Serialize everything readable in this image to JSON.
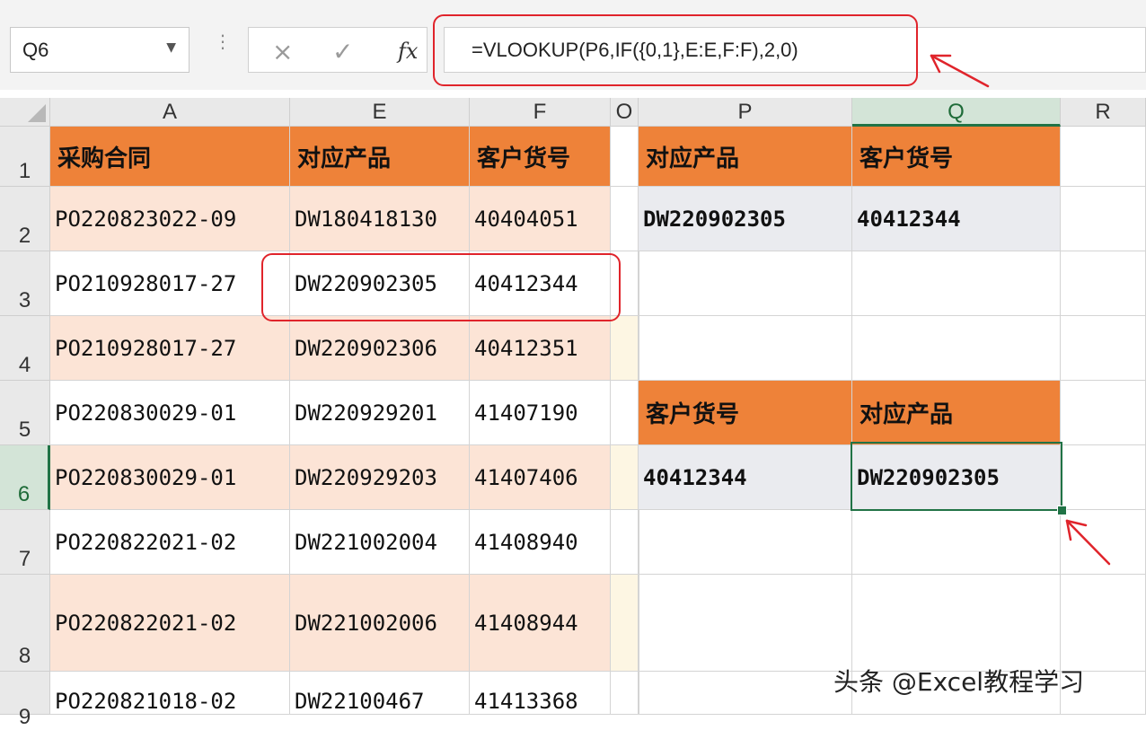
{
  "namebox": {
    "cell_ref": "Q6"
  },
  "formula_bar": {
    "formula": "=VLOOKUP(P6,IF({0,1},E:E,F:F),2,0)"
  },
  "icons": {
    "cancel": "×",
    "enter": "✓",
    "fx": "fx",
    "dropdown": "▼",
    "dots": "⋮"
  },
  "column_headers": [
    "A",
    "E",
    "F",
    "O",
    "P",
    "Q",
    "R"
  ],
  "row_headers": [
    "1",
    "2",
    "3",
    "4",
    "5",
    "6",
    "7",
    "8",
    "9"
  ],
  "table": {
    "headers": [
      "采购合同",
      "对应产品",
      "客户货号"
    ],
    "rows": [
      [
        "PO220823022-09",
        "DW180418130",
        "40404051"
      ],
      [
        "PO210928017-27",
        "DW220902305",
        "40412344"
      ],
      [
        "PO210928017-27",
        "DW220902306",
        "40412351"
      ],
      [
        "PO220830029-01",
        "DW220929201",
        "41407190"
      ],
      [
        "PO220830029-01",
        "DW220929203",
        "41407406"
      ],
      [
        "PO220822021-02",
        "DW221002004",
        "41408940"
      ],
      [
        "PO220822021-02",
        "DW221002006",
        "41408944"
      ],
      [
        "PO220821018-02",
        "DW22100467",
        "41413368"
      ]
    ]
  },
  "lookup1": {
    "headers": [
      "对应产品",
      "客户货号"
    ],
    "values": [
      "DW220902305",
      "40412344"
    ]
  },
  "lookup2": {
    "headers": [
      "客户货号",
      "对应产品"
    ],
    "values": [
      "40412344",
      "DW220902305"
    ]
  },
  "colors": {
    "header_orange": "#ee8239",
    "peach": "#fce4d6",
    "annotation_red": "#e0242b",
    "selection_green": "#217346"
  },
  "watermark": "头条 @Excel教程学习"
}
